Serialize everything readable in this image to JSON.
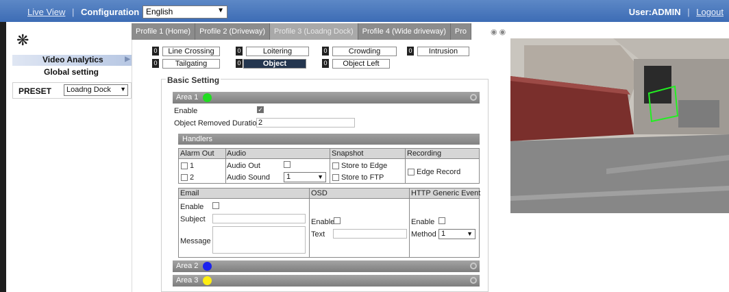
{
  "topnav": {
    "live_view": "Live View",
    "separator": "|",
    "configuration": "Configuration",
    "language": "English"
  },
  "user": {
    "label": "User:ADMIN",
    "separator": "|",
    "logout": "Logout"
  },
  "sidebar": {
    "gear_icon": "gear-icon",
    "video_analytics": "Video Analytics",
    "global_setting": "Global setting",
    "preset_label": "PRESET",
    "preset_value": "Loadng Dock"
  },
  "tabs": [
    "Profile 1 (Home)",
    "Profile 2 (Driveway)",
    "Profile 3 (Loadng Dock)",
    "Profile 4 (Wide driveway)",
    "Pro"
  ],
  "events": [
    {
      "num": "0",
      "label": "Line Crossing"
    },
    {
      "num": "0",
      "label": "Loitering"
    },
    {
      "num": "0",
      "label": "Crowding"
    },
    {
      "num": "0",
      "label": "Intrusion"
    },
    {
      "num": "0",
      "label": "Tailgating"
    },
    {
      "num": "0",
      "label": "Object Removed"
    },
    {
      "num": "0",
      "label": "Object Left"
    }
  ],
  "basic_setting": "Basic Setting",
  "area1": {
    "label": "Area 1",
    "color": "#22dd22",
    "enable_label": "Enable",
    "enabled": true,
    "duration_label": "Object Removed Duration",
    "duration_value": "2"
  },
  "handlers": {
    "title": "Handlers",
    "alarm_out": "Alarm Out",
    "alarm_1": "1",
    "alarm_2": "2",
    "audio": "Audio",
    "audio_out": "Audio Out",
    "audio_sound": "Audio Sound",
    "audio_sound_value": "1",
    "snapshot": "Snapshot",
    "store_edge": "Store to Edge",
    "store_ftp": "Store to FTP",
    "recording": "Recording",
    "edge_record": "Edge Record",
    "email": "Email",
    "email_enable": "Enable",
    "subject": "Subject",
    "message": "Message",
    "osd": "OSD",
    "osd_enable": "Enable",
    "osd_text": "Text",
    "http": "HTTP Generic Event",
    "http_enable": "Enable",
    "method": "Method",
    "method_value": "1"
  },
  "area2": {
    "label": "Area 2",
    "color": "#1b22ee"
  },
  "area3": {
    "label": "Area 3",
    "color": "#ffee11"
  },
  "colors": {
    "topbar": "#3d6cb5",
    "selected_event": "#24364f",
    "region": "#22ee22"
  }
}
